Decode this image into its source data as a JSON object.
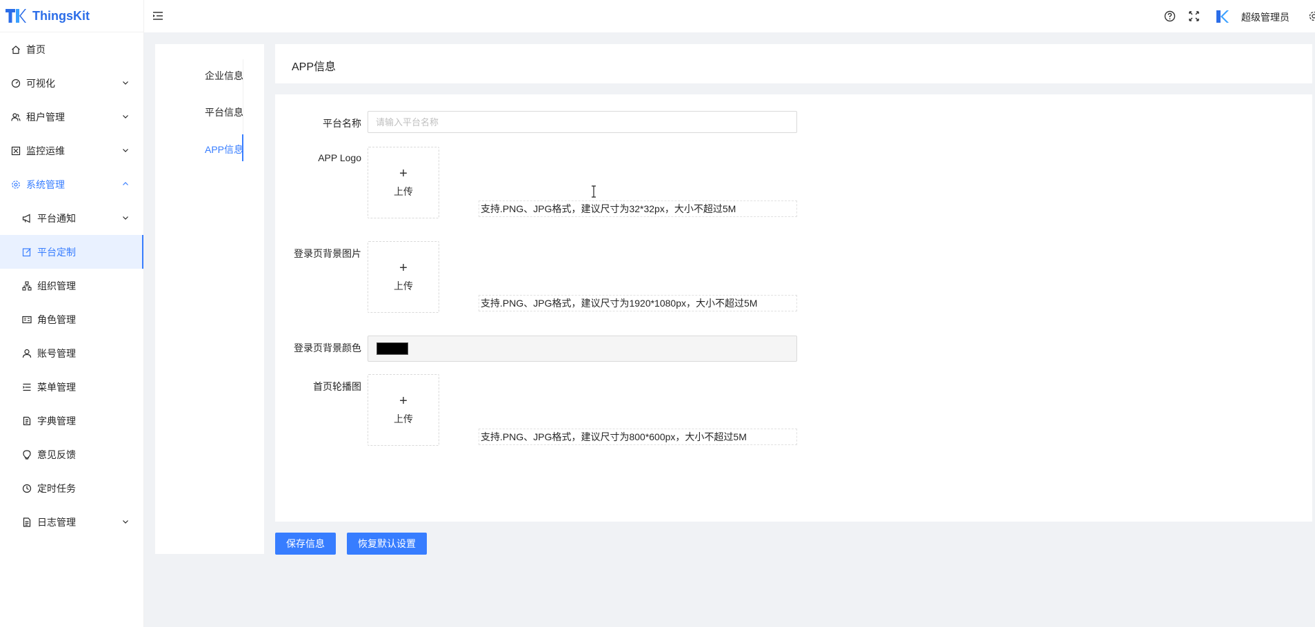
{
  "app": {
    "name": "ThingsKit",
    "brand_color": "#377dff"
  },
  "sidebar": {
    "items": [
      {
        "label": "首页",
        "icon": "home-icon",
        "arrow": false
      },
      {
        "label": "可视化",
        "icon": "dashboard-icon",
        "arrow": true
      },
      {
        "label": "租户管理",
        "icon": "tenant-icon",
        "arrow": true
      },
      {
        "label": "监控运维",
        "icon": "monitor-icon",
        "arrow": true
      },
      {
        "label": "系统管理",
        "icon": "gear-icon",
        "arrow": true,
        "open": true
      },
      {
        "label": "平台通知",
        "icon": "megaphone-icon",
        "arrow": true,
        "sub": true
      },
      {
        "label": "平台定制",
        "icon": "edit-icon",
        "sub": true,
        "active": true
      },
      {
        "label": "组织管理",
        "icon": "org-tree-icon",
        "sub": true
      },
      {
        "label": "角色管理",
        "icon": "id-card-icon",
        "sub": true
      },
      {
        "label": "账号管理",
        "icon": "user-icon",
        "sub": true
      },
      {
        "label": "菜单管理",
        "icon": "menu-list-icon",
        "sub": true
      },
      {
        "label": "字典管理",
        "icon": "book-icon",
        "sub": true
      },
      {
        "label": "意见反馈",
        "icon": "bulb-icon",
        "sub": true
      },
      {
        "label": "定时任务",
        "icon": "clock-icon",
        "sub": true
      },
      {
        "label": "日志管理",
        "icon": "file-log-icon",
        "arrow": true,
        "sub": true
      }
    ]
  },
  "header": {
    "user_name": "超级管理员"
  },
  "tabs": {
    "items": [
      "企业信息",
      "平台信息",
      "APP信息"
    ],
    "active": "APP信息"
  },
  "page": {
    "title": "APP信息"
  },
  "form": {
    "platform_name": {
      "label": "平台名称",
      "placeholder": "请输入平台名称",
      "value": ""
    },
    "app_logo": {
      "label": "APP Logo",
      "upload_label": "上传",
      "hint": "支持.PNG、JPG格式，建议尺寸为32*32px，大小不超过5M"
    },
    "login_bg_image": {
      "label": "登录页背景图片",
      "upload_label": "上传",
      "hint": "支持.PNG、JPG格式，建议尺寸为1920*1080px，大小不超过5M"
    },
    "login_bg_color": {
      "label": "登录页背景颜色",
      "value": "#000000"
    },
    "home_carousel": {
      "label": "首页轮播图",
      "upload_label": "上传",
      "hint": "支持.PNG、JPG格式，建议尺寸为800*600px，大小不超过5M"
    }
  },
  "actions": {
    "save_label": "保存信息",
    "reset_label": "恢复默认设置"
  }
}
